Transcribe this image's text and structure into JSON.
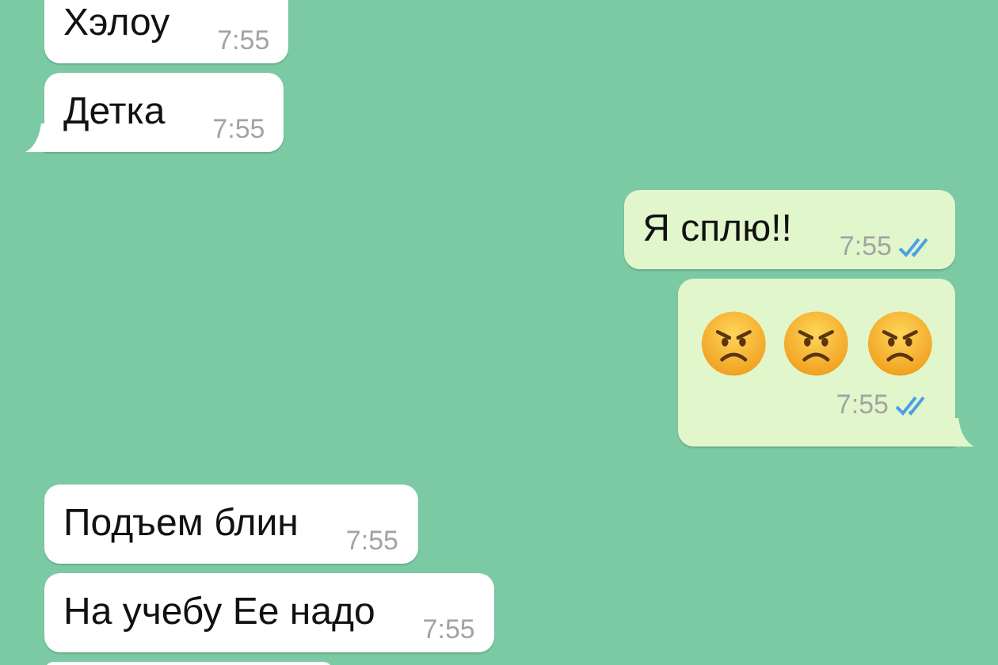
{
  "messages": [
    {
      "kind": "text",
      "outgoing": false,
      "text": "Хэлоу",
      "time": "7:55",
      "tail": false
    },
    {
      "kind": "text",
      "outgoing": false,
      "text": "Детка",
      "time": "7:55",
      "tail": true
    },
    {
      "kind": "text",
      "outgoing": true,
      "text": "Я сплю!!",
      "time": "7:55",
      "read": true,
      "tail": false
    },
    {
      "kind": "emoji",
      "outgoing": true,
      "emojis": [
        {
          "kind": "angry"
        },
        {
          "kind": "angry"
        },
        {
          "kind": "angry"
        }
      ],
      "time": "7:55",
      "read": true,
      "tail": true
    },
    {
      "kind": "text",
      "outgoing": false,
      "text": "Подъем блин",
      "time": "7:55",
      "tail": false
    },
    {
      "kind": "text",
      "outgoing": false,
      "text": "На учебу Ее надо",
      "time": "7:55",
      "tail": false
    },
    {
      "kind": "partial",
      "outgoing": false
    }
  ]
}
